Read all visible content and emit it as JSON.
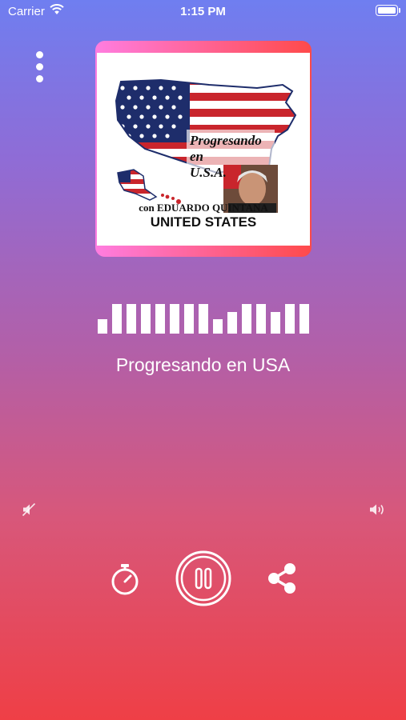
{
  "status_bar": {
    "carrier": "Carrier",
    "time": "1:15 PM"
  },
  "artwork": {
    "title_lines": [
      "Progresando",
      "en",
      "U.S.A."
    ],
    "host_line": "con EDUARDO QUINTANA",
    "country_line": "UNITED STATES",
    "gradient_colors": [
      "#ff7de0",
      "#ff4a4a"
    ]
  },
  "player": {
    "station_name": "Progresando en USA",
    "is_playing": true,
    "equalizer_levels": [
      0.45,
      0.9,
      0.9,
      0.9,
      0.9,
      0.9,
      0.9,
      0.9,
      0.45,
      0.65,
      0.9,
      0.9,
      0.65,
      0.9,
      0.9
    ]
  },
  "icons": {
    "menu": "more-vertical-icon",
    "volume_min": "volume-mute-icon",
    "volume_max": "volume-high-icon",
    "timer": "stopwatch-icon",
    "play_pause": "pause-icon",
    "share": "share-icon"
  },
  "theme": {
    "background_top": "#6f7ef0",
    "background_bottom": "#ef3f46",
    "foreground": "#ffffff"
  }
}
